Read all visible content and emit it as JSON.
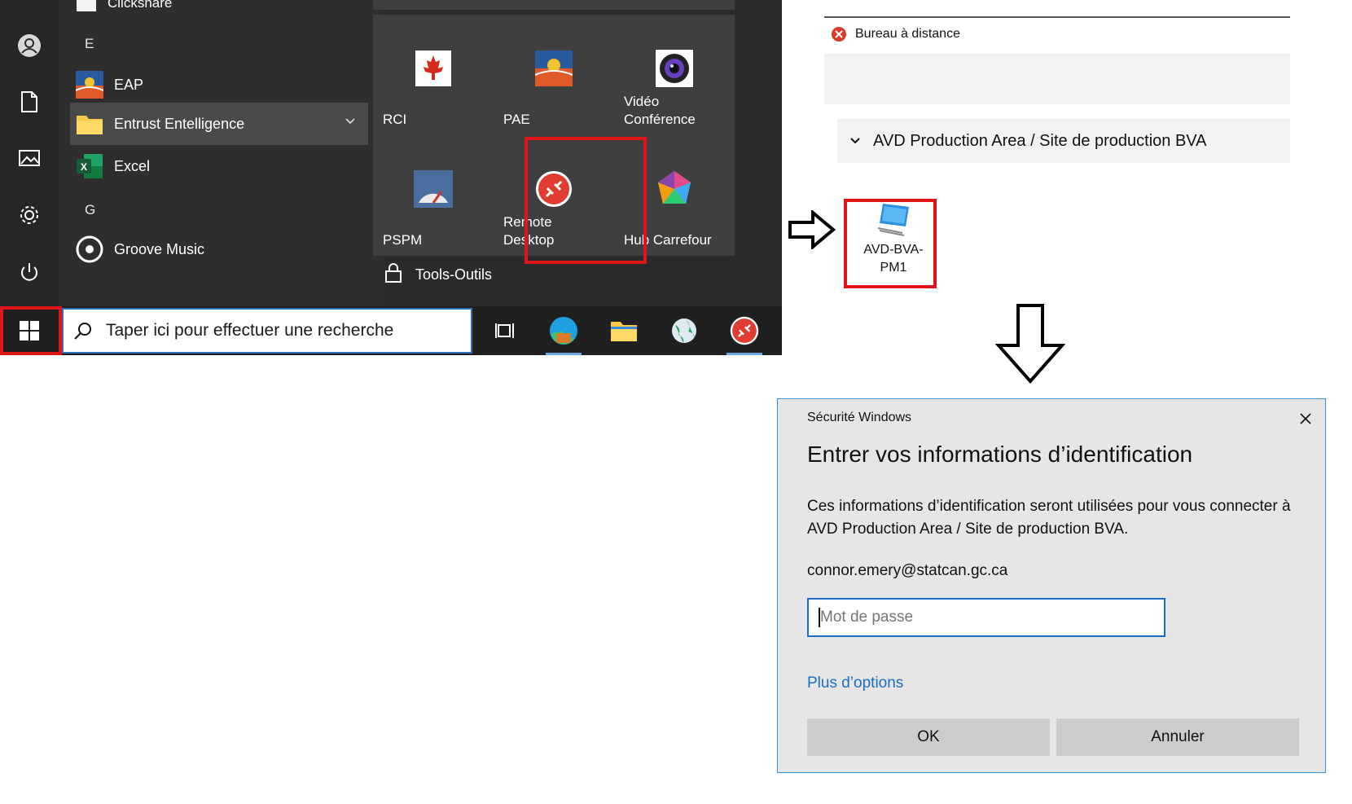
{
  "start_menu": {
    "partial_top_label": "Clickshare",
    "letters": [
      "E",
      "G"
    ],
    "apps": [
      {
        "label": "EAP",
        "icon": "eap-icon"
      },
      {
        "label": "Entrust Entelligence",
        "icon": "folder-icon",
        "expandable": true
      },
      {
        "label": "Excel",
        "icon": "excel-icon"
      },
      {
        "label": "Groove Music",
        "icon": "groove-music-icon"
      }
    ],
    "rail_icons": [
      "user-icon",
      "document-icon",
      "pictures-icon",
      "settings-icon",
      "power-icon"
    ],
    "tiles": [
      {
        "label": "RCI",
        "icon": "maple-leaf-icon"
      },
      {
        "label": "PAE",
        "icon": "pae-icon"
      },
      {
        "label": "Vidéo Conférence",
        "icon": "webcam-icon"
      },
      {
        "label": "PSPM",
        "icon": "gauge-icon"
      },
      {
        "label": "Remote Desktop",
        "icon": "remote-desktop-icon"
      },
      {
        "label": "Hub Carrefour",
        "icon": "hub-icon"
      }
    ],
    "group_label": "Tools-Outils"
  },
  "taskbar": {
    "search_placeholder": "Taper ici pour effectuer une recherche",
    "icons": [
      "start-icon",
      "task-view-icon",
      "edge-icon",
      "file-explorer-icon",
      "globe-icon",
      "remote-desktop-icon"
    ]
  },
  "remote_desktop": {
    "error_label": "Bureau à distance",
    "group_label": "AVD Production Area / Site de production BVA",
    "resource_label": "AVD-BVA-PM1"
  },
  "dialog": {
    "title": "Sécurité Windows",
    "heading": "Entrer vos informations d’identification",
    "description": "Ces informations d’identification seront utilisées pour vous connecter à AVD Production Area / Site de production BVA.",
    "username": "connor.emery@statcan.gc.ca",
    "password_placeholder": "Mot de passe",
    "more_options": "Plus d’options",
    "ok_label": "OK",
    "cancel_label": "Annuler"
  },
  "colors": {
    "highlight_red": "#e0151c",
    "accent_blue": "#1a6fc4",
    "start_bg": "#2b2b2b"
  }
}
